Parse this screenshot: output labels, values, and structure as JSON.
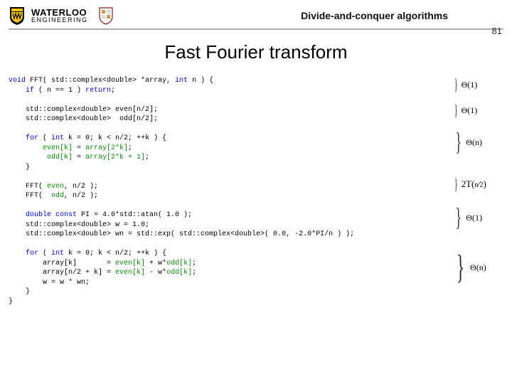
{
  "header": {
    "logo_top": "WATERLOO",
    "logo_bottom": "ENGINEERING",
    "topic": "Divide-and-conquer algorithms",
    "slide_number": "81"
  },
  "title": "Fast Fourier transform",
  "code": {
    "l01a": "void",
    "l01b": " FFT( std::complex<double> *array, ",
    "l01c": "int",
    "l01d": " n ) {",
    "l02a": "    if",
    "l02b": " ( n == 1 ) ",
    "l02c": "return",
    "l02d": ";",
    "l03": "",
    "l04": "    std::complex<double> even[n/2];",
    "l05": "    std::complex<double>  odd[n/2];",
    "l06": "",
    "l07a": "    for",
    "l07b": " ( ",
    "l07c": "int",
    "l07d": " k = 0; k < n/2; ++k ) {",
    "l08a": "        even[k]",
    "l08b": " = ",
    "l08c": "array[2*k]",
    "l08d": ";",
    "l09a": "         odd[k]",
    "l09b": " = ",
    "l09c": "array[2*k + 1]",
    "l09d": ";",
    "l10": "    }",
    "l11": "",
    "l12a": "    FFT( ",
    "l12b": "even",
    "l12c": ", n/2 );",
    "l13a": "    FFT(  ",
    "l13b": "odd",
    "l13c": ", n/2 );",
    "l14": "",
    "l15a": "    double const",
    "l15b": " PI = 4.0*std::atan( 1.0 );",
    "l16": "    std::complex<double> w = 1.0;",
    "l17": "    std::complex<double> wn = std::exp( std::complex<double>( 0.0, -2.0*PI/n ) );",
    "l18": "",
    "l19a": "    for",
    "l19b": " ( ",
    "l19c": "int",
    "l19d": " k = 0; k < n/2; ++k ) {",
    "l20a": "        array[k]       = ",
    "l20b": "even[k]",
    "l20c": " + w*",
    "l20d": "odd[k]",
    "l20e": ";",
    "l21a": "        array[n/2 + k] = ",
    "l21b": "even[k]",
    "l21c": " - w*",
    "l21d": "odd[k]",
    "l21e": ";",
    "l22": "        w = w * wn;",
    "l23": "    }",
    "l24": "}"
  },
  "annotations": {
    "a1": "Θ(1)",
    "a2": "Θ(1)",
    "a3": "Θ(n)",
    "a4": "2T(n/2)",
    "a5": "Θ(1)",
    "a6": "Θ(n)"
  }
}
